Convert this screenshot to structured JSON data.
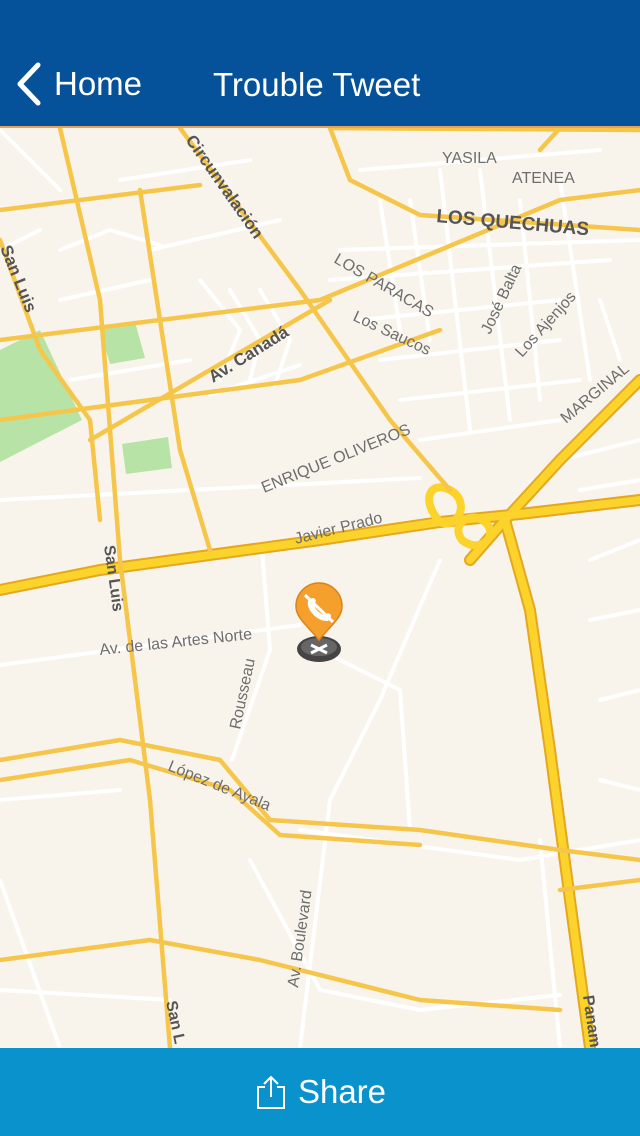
{
  "nav": {
    "back_label": "Home",
    "title": "Trouble Tweet"
  },
  "toolbar": {
    "share_label": "Share"
  },
  "map": {
    "streets": {
      "yasila": "YASILA",
      "atenea": "ATENEA",
      "los_quechuas": "LOS QUECHUAS",
      "circunvalacion": "Circunvalación",
      "san_luis_top": "San Luis",
      "los_paracas": "LOS PARACAS",
      "los_saucos": "Los Saucos",
      "jose_balta": "José Balta",
      "los_ajenjos": "Los Ajenjos",
      "marginal": "MARGINAL",
      "av_canada": "Av. Canadá",
      "enrique_oliveros": "ENRIQUE OLIVEROS",
      "javier_prado": "Javier Prado",
      "san_luis_mid": "San Luis",
      "av_artes_norte": "Av. de las Artes Norte",
      "rousseau": "Rousseau",
      "lopez_de_ayala": "López de Ayala",
      "av_boulevard": "Av. Boulevard",
      "san_luis_bottom": "San L",
      "panam": "Panam"
    },
    "marker_icon": "no-phone-pin-icon",
    "colors": {
      "background": "#f8f4ec",
      "major_road": "#fbd32b",
      "minor_road": "#ffffff",
      "park": "#b7e3a6",
      "marker": "#f5a02c"
    }
  }
}
